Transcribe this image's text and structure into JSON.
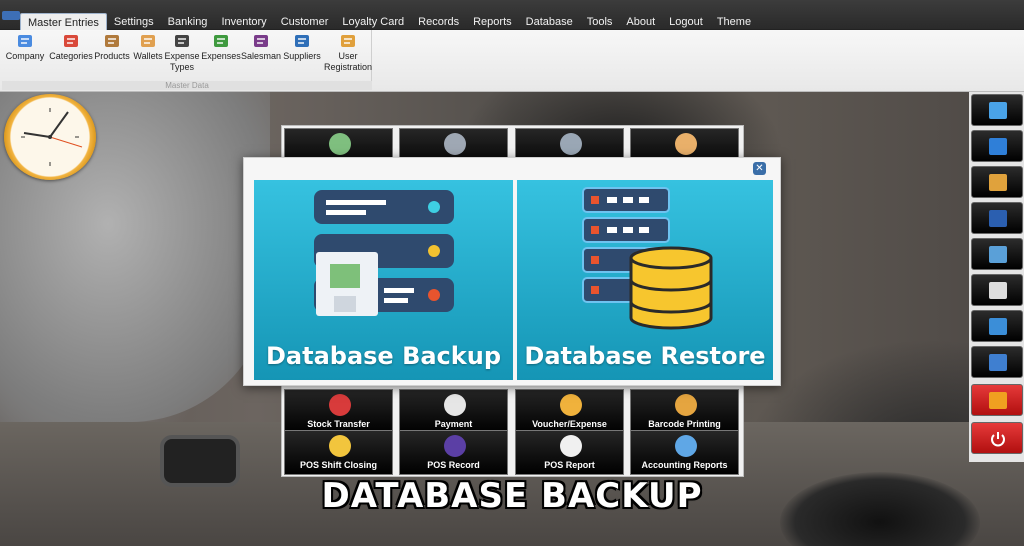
{
  "menu": [
    "Master Entries",
    "Settings",
    "Banking",
    "Inventory",
    "Customer",
    "Loyalty Card",
    "Records",
    "Reports",
    "Database",
    "Tools",
    "About",
    "Logout",
    "Theme"
  ],
  "ribbon": {
    "group_label": "Master Data",
    "buttons": [
      {
        "label": "Company",
        "icon": "company-icon",
        "color": "#4a8be0"
      },
      {
        "label": "Categories",
        "icon": "categories-icon",
        "color": "#d9493a"
      },
      {
        "label": "Products",
        "icon": "products-icon",
        "color": "#b07a3c"
      },
      {
        "label": "Wallets",
        "icon": "wallets-icon",
        "color": "#e0a050"
      },
      {
        "label": "Expense Types",
        "icon": "expense-types-icon",
        "color": "#444444"
      },
      {
        "label": "Expenses",
        "icon": "expenses-icon",
        "color": "#3f9a3f"
      },
      {
        "label": "Salesman",
        "icon": "salesman-icon",
        "color": "#7a3c8a"
      },
      {
        "label": "Suppliers",
        "icon": "suppliers-icon",
        "color": "#2f6fb8"
      },
      {
        "label": "User Registration",
        "icon": "user-registration-icon",
        "color": "#e0a03c"
      }
    ]
  },
  "tiles": [
    {
      "label": "",
      "icon": "money-icon",
      "color": "#7fbf7f"
    },
    {
      "label": "",
      "icon": "settings-icon",
      "color": "#9fa8b4"
    },
    {
      "label": "",
      "icon": "database-icon",
      "color": "#9aa7b5"
    },
    {
      "label": "",
      "icon": "user-icon",
      "color": "#e9b06a"
    },
    {
      "label": "Stock Transfer",
      "icon": "stock-transfer-icon",
      "color": "#d83b3b"
    },
    {
      "label": "Payment",
      "icon": "payment-icon",
      "color": "#e6e6e6"
    },
    {
      "label": "Voucher/Expense",
      "icon": "voucher-icon",
      "color": "#f0b23c"
    },
    {
      "label": "Barcode Printing",
      "icon": "barcode-icon",
      "color": "#e5a540"
    },
    {
      "label": "POS Shift Closing",
      "icon": "shift-closing-icon",
      "color": "#f2c53d"
    },
    {
      "label": "POS Record",
      "icon": "pos-record-icon",
      "color": "#5b3fa5"
    },
    {
      "label": "POS Report",
      "icon": "pos-report-icon",
      "color": "#f0f0f0"
    },
    {
      "label": "Accounting Reports",
      "icon": "accounting-report-icon",
      "color": "#5fa7e6"
    }
  ],
  "dialog": {
    "backup_label": "Database Backup",
    "restore_label": "Database Restore",
    "close_icon": "close-icon"
  },
  "dock": [
    {
      "icon": "notepad-icon",
      "color": "#4aa3e8"
    },
    {
      "icon": "notes-icon",
      "color": "#2f7fd8"
    },
    {
      "icon": "calculator-icon",
      "color": "#e0a23c"
    },
    {
      "icon": "word-icon",
      "color": "#2b5fb0"
    },
    {
      "icon": "remote-desktop-icon",
      "color": "#5aa0d8"
    },
    {
      "icon": "keyboard-icon",
      "color": "#dddddd"
    },
    {
      "icon": "browser-icon",
      "color": "#3b8ed8"
    },
    {
      "icon": "contacts-icon",
      "color": "#3f7fd0"
    },
    {
      "icon": "key-icon",
      "color": "#f0a020"
    },
    {
      "icon": "power-icon",
      "color": "#ffffff"
    }
  ],
  "caption": "DATABASE BACKUP"
}
